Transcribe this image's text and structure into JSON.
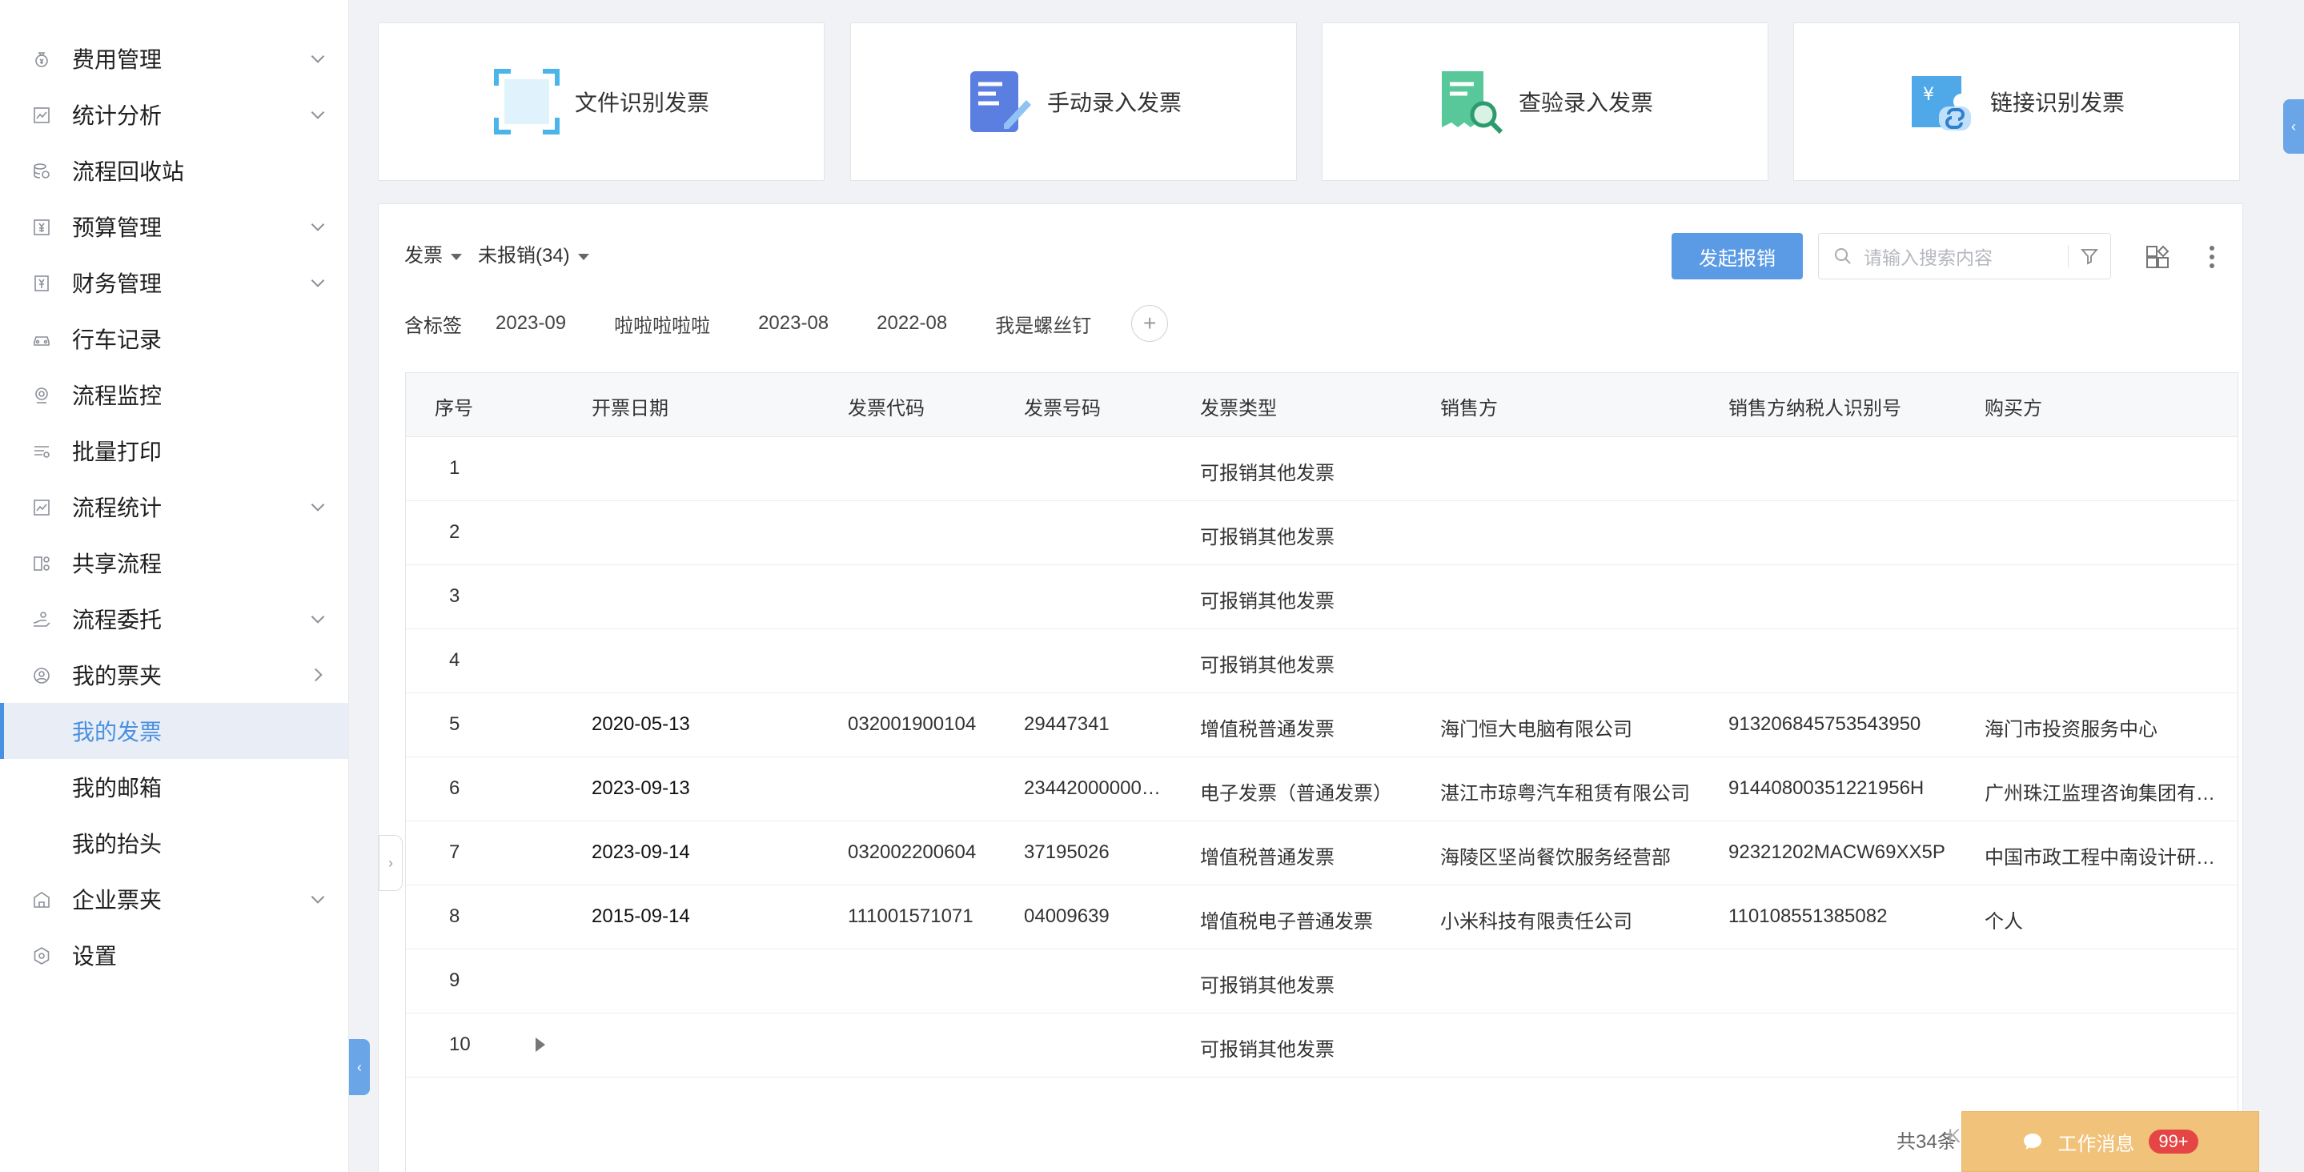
{
  "sidebar": {
    "items": [
      {
        "label": "费用管理",
        "icon": "money-bag-icon",
        "has_arrow": true
      },
      {
        "label": "统计分析",
        "icon": "chart-icon",
        "has_arrow": true
      },
      {
        "label": "流程回收站",
        "icon": "recycle-icon",
        "has_arrow": false
      },
      {
        "label": "预算管理",
        "icon": "budget-icon",
        "has_arrow": true
      },
      {
        "label": "财务管理",
        "icon": "finance-icon",
        "has_arrow": true
      },
      {
        "label": "行车记录",
        "icon": "car-icon",
        "has_arrow": false
      },
      {
        "label": "流程监控",
        "icon": "monitor-icon",
        "has_arrow": false
      },
      {
        "label": "批量打印",
        "icon": "print-icon",
        "has_arrow": false
      },
      {
        "label": "流程统计",
        "icon": "stats-icon",
        "has_arrow": true
      },
      {
        "label": "共享流程",
        "icon": "share-icon",
        "has_arrow": false
      },
      {
        "label": "流程委托",
        "icon": "delegate-icon",
        "has_arrow": true
      },
      {
        "label": "我的票夹",
        "icon": "user-folder-icon",
        "has_arrow": true
      }
    ],
    "sub_items": [
      {
        "label": "我的发票",
        "active": true
      },
      {
        "label": "我的邮箱",
        "active": false
      },
      {
        "label": "我的抬头",
        "active": false
      }
    ],
    "bottom_items": [
      {
        "label": "企业票夹",
        "icon": "company-icon",
        "has_arrow": true
      },
      {
        "label": "设置",
        "icon": "settings-icon",
        "has_arrow": false
      }
    ]
  },
  "cards": [
    {
      "label": "文件识别发票",
      "icon": "scan-frame-icon"
    },
    {
      "label": "手动录入发票",
      "icon": "manual-edit-icon"
    },
    {
      "label": "查验录入发票",
      "icon": "verify-search-icon"
    },
    {
      "label": "链接识别发票",
      "icon": "link-ticket-icon"
    }
  ],
  "toolbar": {
    "filter_type": "发票",
    "filter_status": "未报销(34)",
    "primary_button": "发起报销",
    "search_placeholder": "请输入搜索内容"
  },
  "tags": {
    "label": "含标签",
    "items": [
      "2023-09",
      "啦啦啦啦啦",
      "2023-08",
      "2022-08",
      "我是螺丝钉"
    ],
    "add": "+"
  },
  "table": {
    "columns": [
      "序号",
      "开票日期",
      "发票代码",
      "发票号码",
      "发票类型",
      "销售方",
      "销售方纳税人识别号",
      "购买方"
    ],
    "rows": [
      [
        "1",
        "",
        "",
        "",
        "可报销其他发票",
        "",
        "",
        ""
      ],
      [
        "2",
        "",
        "",
        "",
        "可报销其他发票",
        "",
        "",
        ""
      ],
      [
        "3",
        "",
        "",
        "",
        "可报销其他发票",
        "",
        "",
        ""
      ],
      [
        "4",
        "",
        "",
        "",
        "可报销其他发票",
        "",
        "",
        ""
      ],
      [
        "5",
        "2020-05-13",
        "032001900104",
        "29447341",
        "增值税普通发票",
        "海门恒大电脑有限公司",
        "913206845753543950",
        "海门市投资服务中心"
      ],
      [
        "6",
        "2023-09-13",
        "",
        "23442000000…",
        "电子发票（普通发票）",
        "湛江市琼粤汽车租赁有限公司",
        "91440800351221956H",
        "广州珠江监理咨询集团有限…"
      ],
      [
        "7",
        "2023-09-14",
        "032002200604",
        "37195026",
        "增值税普通发票",
        "海陵区坚尚餐饮服务经营部",
        "92321202MACW69XX5P",
        "中国市政工程中南设计研究…"
      ],
      [
        "8",
        "2015-09-14",
        "111001571071",
        "04009639",
        "增值税电子普通发票",
        "小米科技有限责任公司",
        "110108551385082",
        "个人"
      ],
      [
        "9",
        "",
        "",
        "",
        "可报销其他发票",
        "",
        "",
        ""
      ],
      [
        "10",
        "",
        "",
        "",
        "可报销其他发票",
        "",
        "",
        ""
      ]
    ]
  },
  "pagination": {
    "total": "共34条",
    "first": "K"
  },
  "messages": {
    "label": "工作消息",
    "badge": "99+"
  },
  "colors": {
    "accent": "#5b9be6",
    "message_bar": "#f1c27a",
    "badge": "#e64545"
  }
}
